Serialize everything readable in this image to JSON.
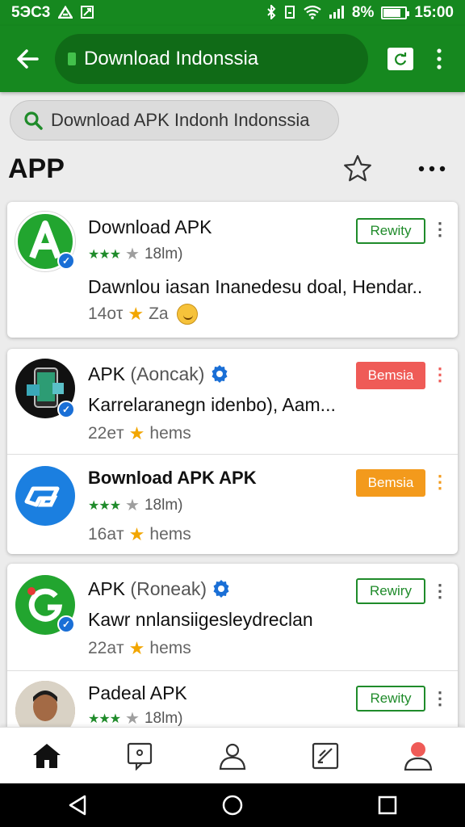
{
  "status_bar": {
    "carrier": "5ЭC3",
    "battery_text": "8%",
    "battery_level": 0.8,
    "time": "15:00"
  },
  "app_bar": {
    "url_text": "Download Indonssia"
  },
  "search": {
    "text": "Download APK Indonh Indonssia"
  },
  "section": {
    "title": "APP"
  },
  "apps": [
    {
      "title": "Download APK",
      "rating_count": "18lm)",
      "description": "Dawnlou iasan Inanedesu doal, Hendar..",
      "meta_count": "14оτ",
      "meta_label": "Zа",
      "button_label": "Rewity",
      "button_style": "outline"
    },
    {
      "title": "APK",
      "subtitle": "(Aoncak)",
      "description": "Karrelaranegn idenbo), Aam...",
      "meta_count": "22eт",
      "meta_label": "hems",
      "button_label": "Bemsia",
      "button_style": "red"
    },
    {
      "title": "Bownload APK APK",
      "rating_count": "18lm)",
      "meta_count": "16aт",
      "meta_label": "hems",
      "button_label": "Bemsia",
      "button_style": "orange"
    },
    {
      "title": "APK",
      "subtitle": "(Roneak)",
      "description": "Kawr nnlansiigesleydreclan",
      "meta_count": "22aт",
      "meta_label": "hems",
      "button_label": "Rewiry",
      "button_style": "outline"
    },
    {
      "title": "Padeal APK",
      "rating_count": "18lm)",
      "button_label": "Rewity",
      "button_style": "outline"
    }
  ],
  "bottom_nav": [
    "home-icon",
    "chat-icon",
    "profile-icon",
    "edit-icon",
    "account-icon"
  ],
  "colors": {
    "primary": "#16881f",
    "primary_dark": "#106b17",
    "star_gold": "#f2a600",
    "button_red": "#ef5b57",
    "button_orange": "#f39a1c",
    "verified_blue": "#1a6fd6"
  }
}
